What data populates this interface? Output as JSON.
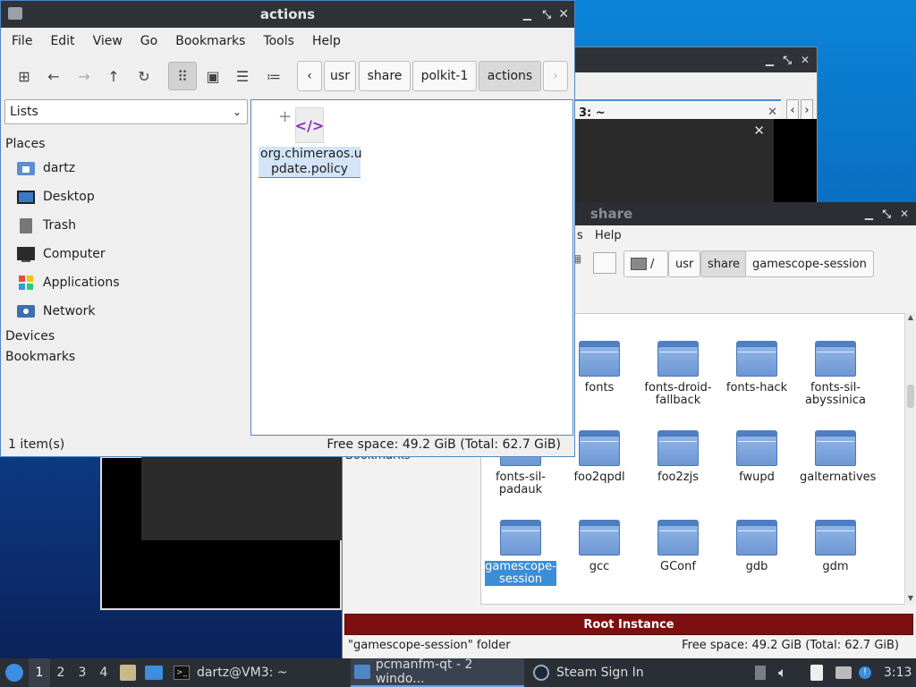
{
  "actions_window": {
    "title": "actions",
    "menu": [
      "File",
      "Edit",
      "View",
      "Go",
      "Bookmarks",
      "Tools",
      "Help"
    ],
    "breadcrumbs": [
      "usr",
      "share",
      "polkit-1",
      "actions"
    ],
    "side_select": "Lists",
    "sections": {
      "places": "Places",
      "devices": "Devices",
      "bookmarks": "Bookmarks"
    },
    "places": [
      "dartz",
      "Desktop",
      "Trash",
      "Computer",
      "Applications",
      "Network"
    ],
    "file": {
      "name": "org.chimeraos.u pdate.policy",
      "line1": "org.chimeraos.u",
      "line2": "pdate.policy"
    },
    "status_left": "1 item(s)",
    "status_right": "Free space: 49.2 GiB (Total: 62.7 GiB)"
  },
  "terminal_window": {
    "tab_title": "3: ~"
  },
  "share_window": {
    "title": "share",
    "menu_partial": "s",
    "menu_help": "Help",
    "breadcrumbs": [
      "/",
      "usr",
      "share",
      "gamescope-session"
    ],
    "side_text": "Bookmarks",
    "files": [
      {
        "label": "fonts"
      },
      {
        "label": "fonts-droid-fallback"
      },
      {
        "label": "fonts-hack"
      },
      {
        "label": "fonts-sil-abyssinica"
      },
      {
        "label": "fonts-sil-padauk"
      },
      {
        "label": "foo2qpdl"
      },
      {
        "label": "foo2zjs"
      },
      {
        "label": "fwupd"
      },
      {
        "label": "galternatives"
      },
      {
        "label": "gamescope-session",
        "selected": true
      },
      {
        "label": "gcc"
      },
      {
        "label": "GConf"
      },
      {
        "label": "gdb"
      },
      {
        "label": "gdm"
      }
    ],
    "banner": "Root Instance",
    "status_left": "\"gamescope-session\" folder",
    "status_right": "Free space: 49.2 GiB (Total: 62.7 GiB)"
  },
  "taskbar": {
    "workspaces": [
      "1",
      "2",
      "3",
      "4"
    ],
    "tasks": [
      "dartz@VM3: ~",
      "pcmanfm-qt - 2 windo...",
      "Steam Sign In"
    ],
    "clock": "3:13"
  },
  "colors": {
    "accent": "#3a8ed6",
    "titlebar": "#2f3338",
    "banner": "#7e0f10",
    "folder": "#6d97d4"
  }
}
